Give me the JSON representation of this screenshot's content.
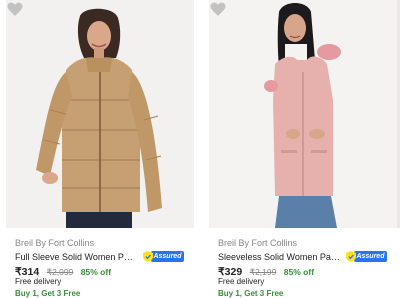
{
  "products": [
    {
      "brand": "Breil By Fort Collins",
      "name": "Full Sleeve Solid Women Padded Jacket",
      "assured": "Assured",
      "price": "₹314",
      "mrp": "₹2,099",
      "discount": "85% off",
      "delivery": "Free delivery",
      "offer": "Buy 1, Get 3 Free",
      "image_icon": "woman-camel-padded-jacket"
    },
    {
      "brand": "Breil By Fort Collins",
      "name": "Sleeveless Solid Women Parka Jacket",
      "assured": "Assured",
      "price": "₹329",
      "mrp": "₹2,199",
      "discount": "85% off",
      "delivery": "Free delivery",
      "offer": "Buy 1, Get 3 Free",
      "image_icon": "woman-pink-parka-vest"
    }
  ],
  "colors": {
    "price_green": "#388e3c",
    "assured_blue": "#2874f0",
    "muted": "#878787",
    "wishlist_grey": "#c2c2c2"
  }
}
